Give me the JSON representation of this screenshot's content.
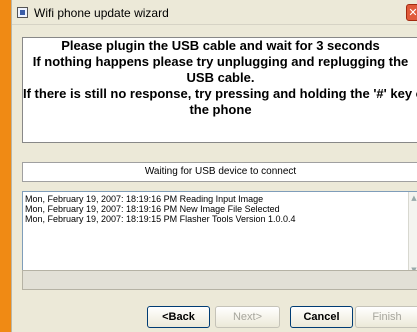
{
  "window": {
    "title": "Wifi phone update wizard",
    "close_glyph": "✕"
  },
  "message": {
    "lines": [
      "Please plugin the USB cable and wait for 3 seconds",
      "If nothing happens please try unplugging and replugging the",
      "USB cable.",
      "If there is still no response, try pressing and holding the '#' key on",
      "the phone"
    ]
  },
  "status": {
    "text": "Waiting for USB device to connect"
  },
  "log": {
    "lines": [
      "Mon, February 19, 2007:  18:19:16 PM  Reading Input Image",
      "Mon, February 19, 2007:  18:19:16 PM  New Image File Selected",
      "Mon, February 19, 2007:  18:19:15 PM  Flasher Tools Version 1.0.0.4"
    ]
  },
  "progress": {
    "fraction": 0
  },
  "buttons": {
    "back": "<Back",
    "next": "Next>",
    "cancel": "Cancel",
    "finish": "Finish"
  },
  "colors": {
    "accent": "#f08a14",
    "window_bg": "#ece9d8",
    "close_button": "#e05a3a"
  }
}
